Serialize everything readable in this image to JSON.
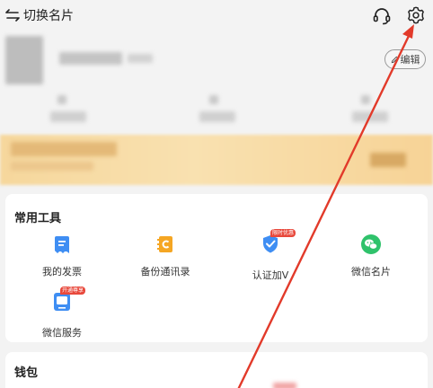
{
  "header": {
    "switch_label": "切换名片",
    "switch_icon": "switch-arrows-icon",
    "support_icon": "headset-icon",
    "settings_icon": "gear-icon"
  },
  "profile": {
    "edit_label": "编辑"
  },
  "tools": {
    "title": "常用工具",
    "items": [
      {
        "label": "我的发票",
        "icon": "invoice-icon",
        "color": "#3f8ef3"
      },
      {
        "label": "备份通讯录",
        "icon": "contacts-backup-icon",
        "color": "#f5a623"
      },
      {
        "label": "认证加V",
        "icon": "verified-shield-icon",
        "color": "#3f8ef3",
        "badge": "限时优惠"
      },
      {
        "label": "微信名片",
        "icon": "wechat-icon",
        "color": "#2fc26b"
      },
      {
        "label": "微信服务",
        "icon": "wechat-service-icon",
        "color": "#3f8ef3",
        "badge": "开通尊享"
      }
    ]
  },
  "wallet": {
    "title": "钱包"
  },
  "colors": {
    "annotation_arrow": "#e23a2a",
    "banner": "#f6d79c"
  }
}
